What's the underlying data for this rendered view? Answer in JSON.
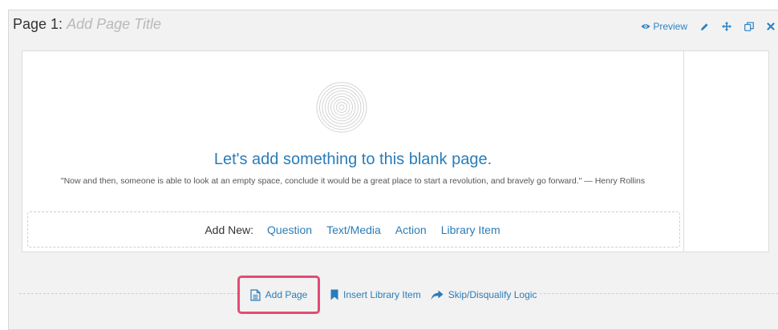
{
  "header": {
    "page_label": "Page 1:",
    "title_placeholder": "Add Page Title"
  },
  "toolbar": {
    "preview_label": "Preview",
    "icons": [
      "eye-icon",
      "pencil-icon",
      "move-icon",
      "copy-icon",
      "close-icon"
    ]
  },
  "blank_page": {
    "heading": "Let's add something to this blank page.",
    "quote": "\"Now and then, someone is able to look at an empty space, conclude it would be a great place to start a revolution, and bravely go forward.\" — Henry Rollins"
  },
  "add_new": {
    "label": "Add New:",
    "links": [
      "Question",
      "Text/Media",
      "Action",
      "Library Item"
    ]
  },
  "footer": {
    "add_page": "Add Page",
    "insert_library": "Insert Library Item",
    "skip_logic": "Skip/Disqualify Logic"
  },
  "colors": {
    "accent": "#2a7cb8",
    "highlight": "#e34b74",
    "panel_bg": "#f2f2f2"
  }
}
